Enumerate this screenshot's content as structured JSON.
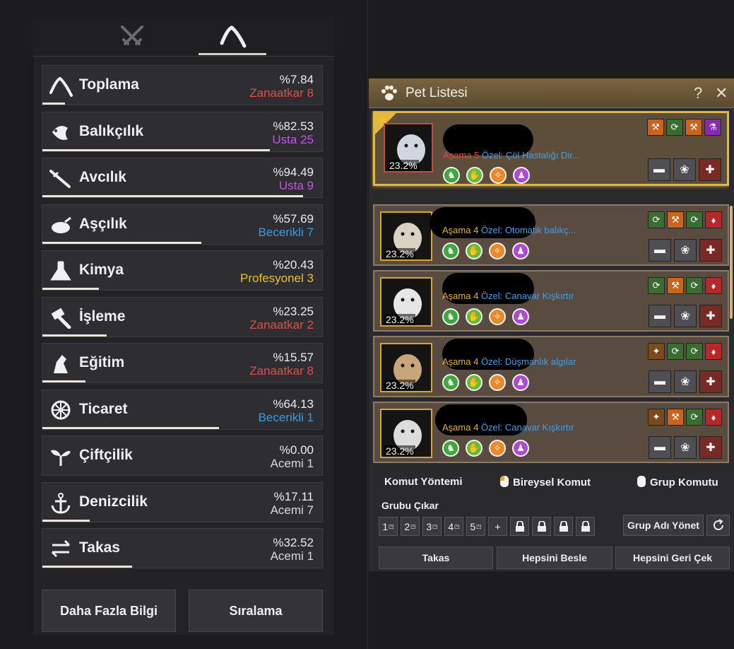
{
  "skills_panel": {
    "tabs": [
      {
        "name": "combat",
        "icon": "crossed-swords-icon"
      },
      {
        "name": "life",
        "icon": "pickaxe-icon"
      }
    ],
    "skills": [
      {
        "name": "Toplama",
        "percent": "%7.84",
        "rank": "Zanaatkar",
        "level": "8",
        "rank_color": "#e24d4a",
        "progress": 0.0784,
        "icon": "pickaxe-icon"
      },
      {
        "name": "Balıkçılık",
        "percent": "%82.53",
        "rank": "Usta",
        "level": "25",
        "rank_color": "#c455e8",
        "progress": 0.8253,
        "icon": "fish-icon"
      },
      {
        "name": "Avcılık",
        "percent": "%94.49",
        "rank": "Usta",
        "level": "9",
        "rank_color": "#c455e8",
        "progress": 0.9449,
        "icon": "rifle-icon"
      },
      {
        "name": "Aşçılık",
        "percent": "%57.69",
        "rank": "Becerikli",
        "level": "7",
        "rank_color": "#3a9ae4",
        "progress": 0.5769,
        "icon": "cooking-icon"
      },
      {
        "name": "Kimya",
        "percent": "%20.43",
        "rank": "Profesyonel",
        "level": "3",
        "rank_color": "#e8c036",
        "progress": 0.2043,
        "icon": "flask-icon"
      },
      {
        "name": "İşleme",
        "percent": "%23.25",
        "rank": "Zanaatkar",
        "level": "2",
        "rank_color": "#e24d4a",
        "progress": 0.2325,
        "icon": "hammer-icon"
      },
      {
        "name": "Eğitim",
        "percent": "%15.57",
        "rank": "Zanaatkar",
        "level": "8",
        "rank_color": "#e24d4a",
        "progress": 0.1557,
        "icon": "horse-icon"
      },
      {
        "name": "Ticaret",
        "percent": "%64.13",
        "rank": "Becerikli",
        "level": "1",
        "rank_color": "#3a9ae4",
        "progress": 0.6413,
        "icon": "wheel-icon"
      },
      {
        "name": "Çiftçilik",
        "percent": "%0.00",
        "rank": "Acemi",
        "level": "1",
        "rank_color": "#d8d8d8",
        "progress": 0.0,
        "icon": "sprout-icon"
      },
      {
        "name": "Denizcilik",
        "percent": "%17.11",
        "rank": "Acemi",
        "level": "7",
        "rank_color": "#d8d8d8",
        "progress": 0.1711,
        "icon": "anchor-icon"
      },
      {
        "name": "Takas",
        "percent": "%32.52",
        "rank": "Acemi",
        "level": "1",
        "rank_color": "#d8d8d8",
        "progress": 0.3252,
        "icon": "exchange-icon"
      }
    ],
    "buttons": {
      "more_info": "Daha Fazla Bilgi",
      "sort": "Sıralama"
    }
  },
  "pet_panel": {
    "title": "Pet Listesi",
    "help": "?",
    "close": "✕",
    "pets": [
      {
        "stage_label": "Aşama 5",
        "special": "Özel: Çöl Hastalığı Dir...",
        "hunger": "23.2%",
        "leader": true,
        "stage_color": "red",
        "talents": [
          "t-orange",
          "t-green",
          "t-orange",
          "t-purple"
        ]
      },
      {
        "stage_label": "Aşama 4",
        "special": "Özel: Otomatik balıkç...",
        "hunger": "23.2%",
        "leader": false,
        "stage_color": "gold",
        "talents": [
          "t-green",
          "t-orange",
          "t-green",
          "t-red"
        ]
      },
      {
        "stage_label": "Aşama 4",
        "special": "Özel: Canavar Kışkırtır",
        "hunger": "23.2%",
        "leader": false,
        "stage_color": "gold",
        "talents": [
          "t-green",
          "t-orange",
          "t-green",
          "t-red"
        ]
      },
      {
        "stage_label": "Aşama 4",
        "special": "Özel: Düşmanlık algılar",
        "hunger": "23.2%",
        "leader": false,
        "stage_color": "gold",
        "talents": [
          "t-brown",
          "t-green",
          "t-green",
          "t-red"
        ]
      },
      {
        "stage_label": "Aşama 4",
        "special": "Özel: Canavar Kışkırtır",
        "hunger": "23.2%",
        "leader": false,
        "stage_color": "gold",
        "talents": [
          "t-brown",
          "t-orange",
          "t-green",
          "t-red"
        ]
      }
    ],
    "command": {
      "method_label": "Komut Yöntemi",
      "individual": "Bireysel Komut",
      "group": "Grup Komutu"
    },
    "group": {
      "label": "Grubu Çıkar",
      "slots": [
        "1",
        "2",
        "3",
        "4",
        "5"
      ],
      "manage_name": "Grup Adı Yönet"
    },
    "footer": {
      "trade": "Takas",
      "feed_all": "Hepsini Besle",
      "recall_all": "Hepsini Geri Çek"
    }
  }
}
